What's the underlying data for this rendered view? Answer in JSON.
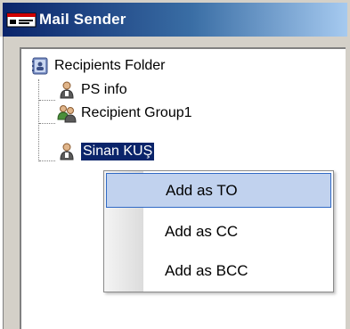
{
  "window": {
    "title": "Mail Sender",
    "title_icon": "mail-card-icon"
  },
  "tree": {
    "root": {
      "label": "Recipients Folder",
      "icon": "address-book-icon"
    },
    "children": [
      {
        "label": "PS info",
        "icon": "person-icon",
        "selected": false
      },
      {
        "label": "Recipient Group1",
        "icon": "group-icon",
        "selected": false
      },
      {
        "label": "Sinan KUŞ",
        "icon": "person-icon",
        "selected": true
      }
    ]
  },
  "context_menu": {
    "items": [
      {
        "label": "Add as TO",
        "highlighted": true
      },
      {
        "label": "Add as CC",
        "highlighted": false
      },
      {
        "label": "Add as BCC",
        "highlighted": false
      }
    ]
  },
  "colors": {
    "selection_bg": "#0a246a",
    "menu_highlight_bg": "#c1d2ee",
    "menu_highlight_border": "#316ac5",
    "titlebar_start": "#0a246a",
    "titlebar_end": "#a6caf0"
  }
}
